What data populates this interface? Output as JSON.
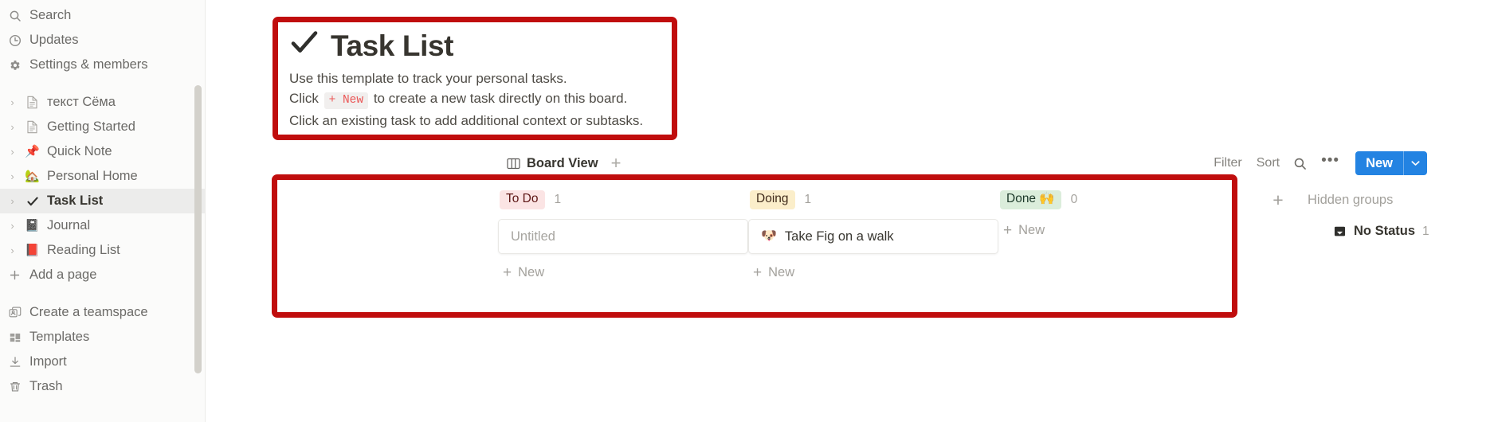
{
  "sidebar": {
    "top_items": [
      {
        "label": "Search",
        "icon": "search-icon"
      },
      {
        "label": "Updates",
        "icon": "clock-icon"
      },
      {
        "label": "Settings & members",
        "icon": "gear-icon"
      }
    ],
    "pages": [
      {
        "label": "текст Сёма",
        "emoji": "",
        "icon": "document-icon",
        "selected": false
      },
      {
        "label": "Getting Started",
        "emoji": "",
        "icon": "document-icon",
        "selected": false
      },
      {
        "label": "Quick Note",
        "emoji": "📌",
        "icon": "",
        "selected": false
      },
      {
        "label": "Personal Home",
        "emoji": "🏡",
        "icon": "",
        "selected": false
      },
      {
        "label": "Task List",
        "emoji": "✔️",
        "icon": "",
        "selected": true
      },
      {
        "label": "Journal",
        "emoji": "📓",
        "icon": "",
        "selected": false
      },
      {
        "label": "Reading List",
        "emoji": "📕",
        "icon": "",
        "selected": false
      }
    ],
    "add_page": {
      "label": "Add a page",
      "icon": "plus-icon"
    },
    "bottom_items": [
      {
        "label": "Create a teamspace",
        "icon": "teamspace-icon"
      },
      {
        "label": "Templates",
        "icon": "templates-icon"
      },
      {
        "label": "Import",
        "icon": "import-icon"
      },
      {
        "label": "Trash",
        "icon": "trash-icon"
      }
    ]
  },
  "callout": {
    "check_glyph": "✓",
    "title": "Task List",
    "line1": "Use this template to track your personal tasks.",
    "line2_before": "Click",
    "line2_code": "+ New",
    "line2_after": "to create a new task directly on this board.",
    "line3": "Click an existing task to add additional context or subtasks."
  },
  "toolbar": {
    "view_label": "Board View",
    "add_view_glyph": "+",
    "filter_label": "Filter",
    "sort_label": "Sort",
    "search_icon": "search-icon",
    "more_glyph": "•••",
    "new_label": "New",
    "new_caret_glyph": "⌄"
  },
  "board": {
    "columns": [
      {
        "tag": "To Do",
        "tag_class": "tag-todo",
        "count": "1",
        "cards": [
          {
            "emoji": "",
            "title": "",
            "placeholder": "Untitled"
          }
        ],
        "new_label": "New"
      },
      {
        "tag": "Doing",
        "tag_class": "tag-doing",
        "count": "1",
        "cards": [
          {
            "emoji": "🐶",
            "title": "Take Fig on a walk",
            "placeholder": ""
          }
        ],
        "new_label": "New"
      },
      {
        "tag": "Done 🙌",
        "tag_class": "tag-done",
        "count": "0",
        "cards": [],
        "new_label": "New"
      }
    ],
    "add_group_glyph": "+",
    "hidden_groups": {
      "title": "Hidden groups",
      "items": [
        {
          "label": "No Status",
          "count": "1",
          "icon": "tray-icon"
        }
      ]
    }
  },
  "colors": {
    "annotation_red": "#c00d0d",
    "accent_blue": "#2383e2",
    "tag_todo_bg": "#fbe4e4",
    "tag_doing_bg": "#fbeeca",
    "tag_done_bg": "#dbeddb",
    "code_red": "#eb5757",
    "sidebar_bg": "#fbfbfa"
  }
}
